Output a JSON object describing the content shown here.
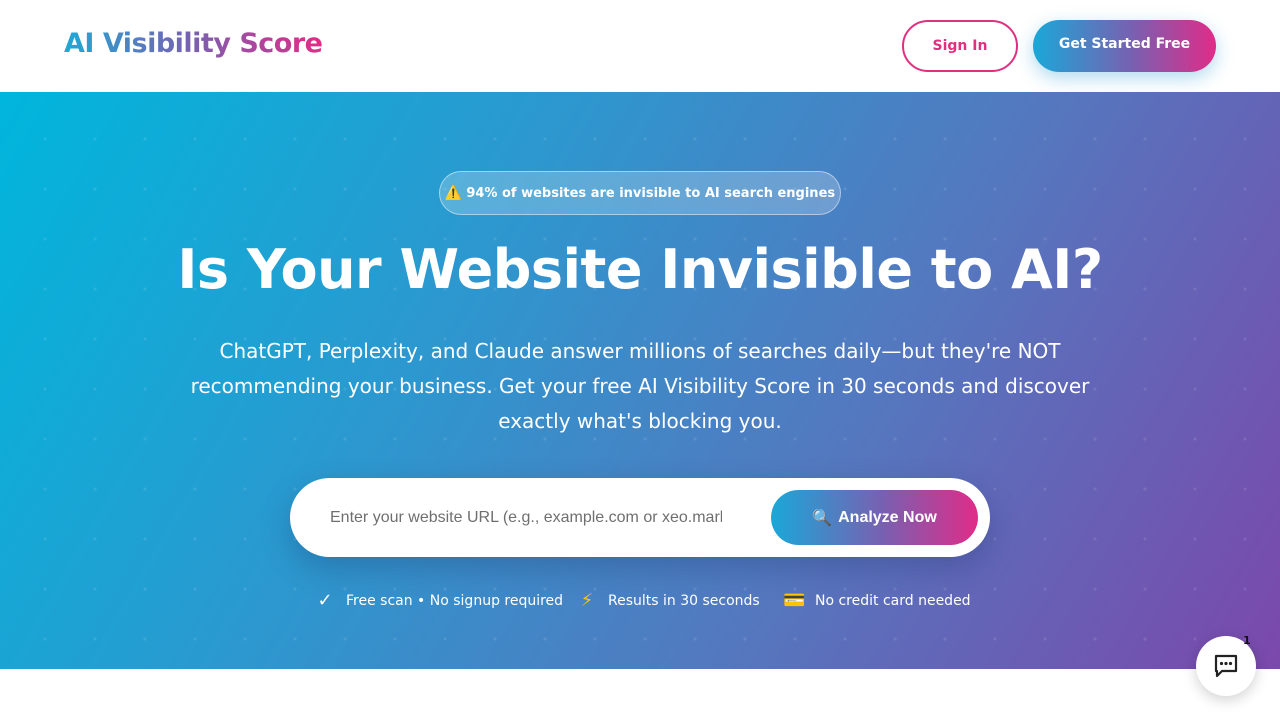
{
  "header": {
    "logo": "AI Visibility Score",
    "signin_label": "Sign In",
    "cta_label": "Get Started Free"
  },
  "hero": {
    "badge_icon": "⚠️",
    "badge_text": "94% of websites are invisible to AI search engines",
    "title": "Is Your Website Invisible to AI?",
    "subtitle": "ChatGPT, Perplexity, and Claude answer millions of searches daily—but they're NOT recommending your business. Get your free AI Visibility Score in 30 seconds and discover exactly what's blocking you.",
    "search": {
      "placeholder": "Enter your website URL (e.g., example.com or xeo.marketing)",
      "value": "",
      "button_icon": "🔍",
      "button_label": "Analyze Now"
    },
    "features": [
      {
        "icon": "✓",
        "text": "Free scan • No signup required"
      },
      {
        "icon": "⚡",
        "text": "Results in 30 seconds"
      },
      {
        "icon": "💳",
        "text": "No credit card needed"
      }
    ]
  },
  "chat_widget": {
    "icon": "chat-bubble-icon",
    "count": "1"
  },
  "colors": {
    "brand_pink": "#e0307f",
    "brand_cyan": "#1aa8d8",
    "brand_purple": "#7a5fb0"
  }
}
